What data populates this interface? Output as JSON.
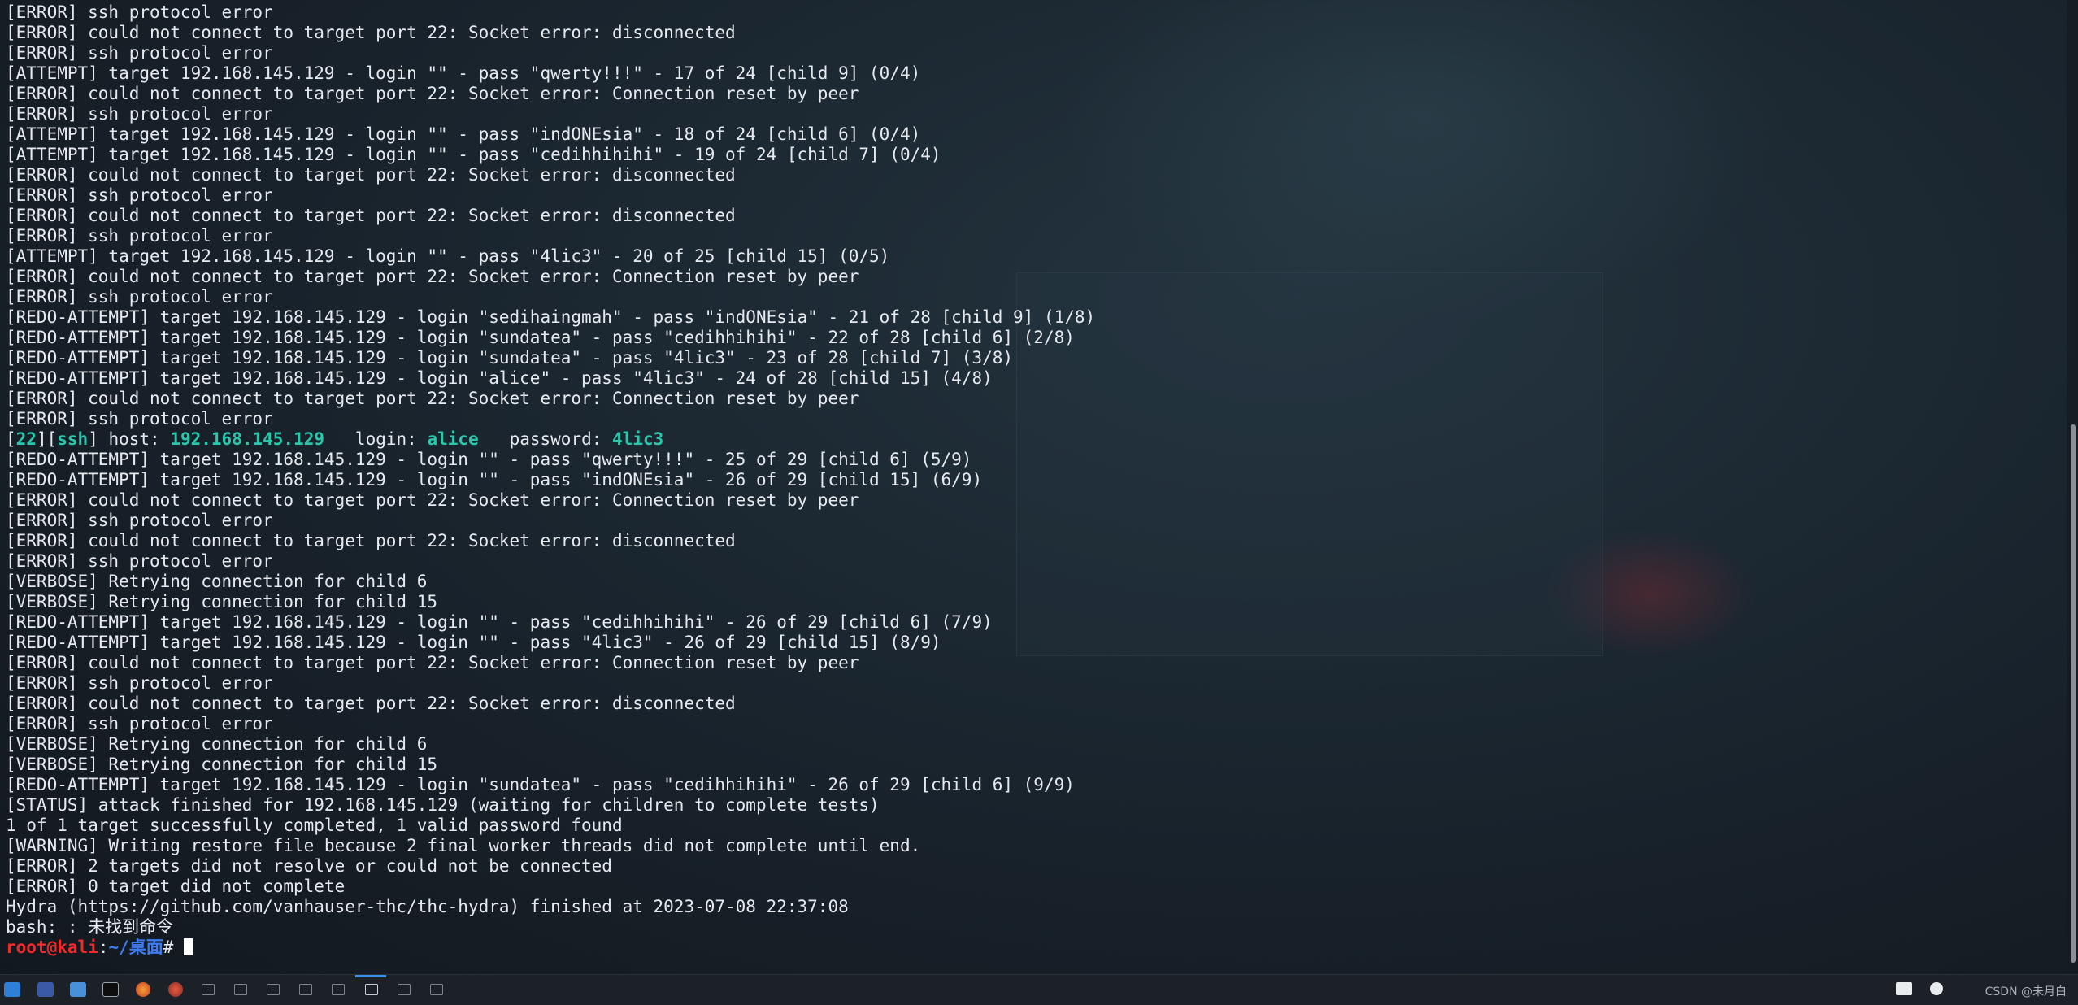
{
  "terminal": {
    "lines": [
      "[ERROR] ssh protocol error",
      "[ERROR] could not connect to target port 22: Socket error: disconnected",
      "[ERROR] ssh protocol error",
      "[ATTEMPT] target 192.168.145.129 - login \"\" - pass \"qwerty!!!\" - 17 of 24 [child 9] (0/4)",
      "[ERROR] could not connect to target port 22: Socket error: Connection reset by peer",
      "[ERROR] ssh protocol error",
      "[ATTEMPT] target 192.168.145.129 - login \"\" - pass \"indONEsia\" - 18 of 24 [child 6] (0/4)",
      "[ATTEMPT] target 192.168.145.129 - login \"\" - pass \"cedihhihihi\" - 19 of 24 [child 7] (0/4)",
      "[ERROR] could not connect to target port 22: Socket error: disconnected",
      "[ERROR] ssh protocol error",
      "[ERROR] could not connect to target port 22: Socket error: disconnected",
      "[ERROR] ssh protocol error",
      "[ATTEMPT] target 192.168.145.129 - login \"\" - pass \"4lic3\" - 20 of 25 [child 15] (0/5)",
      "[ERROR] could not connect to target port 22: Socket error: Connection reset by peer",
      "[ERROR] ssh protocol error",
      "[REDO-ATTEMPT] target 192.168.145.129 - login \"sedihaingmah\" - pass \"indONEsia\" - 21 of 28 [child 9] (1/8)",
      "[REDO-ATTEMPT] target 192.168.145.129 - login \"sundatea\" - pass \"cedihhihihi\" - 22 of 28 [child 6] (2/8)",
      "[REDO-ATTEMPT] target 192.168.145.129 - login \"sundatea\" - pass \"4lic3\" - 23 of 28 [child 7] (3/8)",
      "[REDO-ATTEMPT] target 192.168.145.129 - login \"alice\" - pass \"4lic3\" - 24 of 28 [child 15] (4/8)",
      "[ERROR] could not connect to target port 22: Socket error: Connection reset by peer",
      "[ERROR] ssh protocol error"
    ],
    "found": {
      "open_bracket": "[",
      "port": "22",
      "mid_bracket": "][",
      "service": "ssh",
      "host_label": "] host: ",
      "host": "192.168.145.129",
      "login_label": "   login: ",
      "login": "alice",
      "password_label": "   password: ",
      "password": "4lic3"
    },
    "lines2": [
      "[REDO-ATTEMPT] target 192.168.145.129 - login \"\" - pass \"qwerty!!!\" - 25 of 29 [child 6] (5/9)",
      "[REDO-ATTEMPT] target 192.168.145.129 - login \"\" - pass \"indONEsia\" - 26 of 29 [child 15] (6/9)",
      "[ERROR] could not connect to target port 22: Socket error: Connection reset by peer",
      "[ERROR] ssh protocol error",
      "[ERROR] could not connect to target port 22: Socket error: disconnected",
      "[ERROR] ssh protocol error",
      "[VERBOSE] Retrying connection for child 6",
      "[VERBOSE] Retrying connection for child 15",
      "[REDO-ATTEMPT] target 192.168.145.129 - login \"\" - pass \"cedihhihihi\" - 26 of 29 [child 6] (7/9)",
      "[REDO-ATTEMPT] target 192.168.145.129 - login \"\" - pass \"4lic3\" - 26 of 29 [child 15] (8/9)",
      "[ERROR] could not connect to target port 22: Socket error: Connection reset by peer",
      "[ERROR] ssh protocol error",
      "[ERROR] could not connect to target port 22: Socket error: disconnected",
      "[ERROR] ssh protocol error",
      "[VERBOSE] Retrying connection for child 6",
      "[VERBOSE] Retrying connection for child 15",
      "[REDO-ATTEMPT] target 192.168.145.129 - login \"sundatea\" - pass \"cedihhihihi\" - 26 of 29 [child 6] (9/9)",
      "[STATUS] attack finished for 192.168.145.129 (waiting for children to complete tests)",
      "1 of 1 target successfully completed, 1 valid password found",
      "[WARNING] Writing restore file because 2 final worker threads did not complete until end.",
      "[ERROR] 2 targets did not resolve or could not be connected",
      "[ERROR] 0 target did not complete",
      "Hydra (https://github.com/vanhauser-thc/thc-hydra) finished at 2023-07-08 22:37:08",
      "bash: : 未找到命令"
    ],
    "prompt": {
      "user_host": "root@kali",
      "colon": ":",
      "path": "~/桌面",
      "symbol": "# "
    }
  },
  "taskbar": {
    "icons": [
      "kali-menu-icon",
      "desktop-icon",
      "file-manager-icon",
      "terminal-icon",
      "firefox-icon",
      "firefox-icon-2",
      "window-1-icon",
      "window-2-icon",
      "window-3-icon",
      "window-4-icon",
      "window-5-icon",
      "window-6-active-icon",
      "window-7-icon",
      "window-8-icon"
    ],
    "tray_icons": [
      "chat-icon",
      "network-icon"
    ],
    "watermark": "CSDN @未月白"
  },
  "colors": {
    "text": "#e6eaee",
    "success_green": "#29c7ac",
    "prompt_red": "#f02a2a",
    "prompt_blue": "#3f7cf0",
    "taskbar_active": "#3b8eea"
  }
}
